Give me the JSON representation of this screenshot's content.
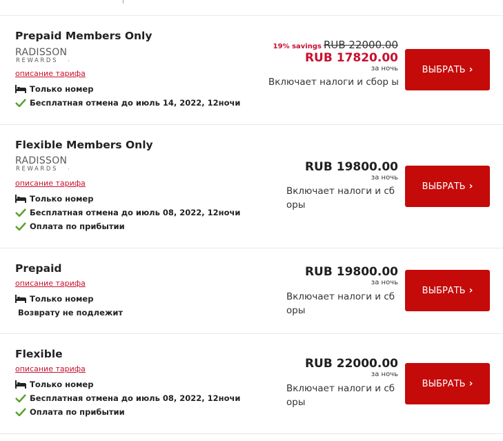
{
  "rates": [
    {
      "title": "Prepaid Members Only",
      "logo_top": "RADISSON",
      "logo_bottom": "REWARDS",
      "description_link": "описание тарифа",
      "features": [
        {
          "icon": "bed-icon",
          "text": "Только номер"
        },
        {
          "icon": "check-icon",
          "text": "Бесплатная отмена до июль 14, 2022, 12ночи"
        }
      ],
      "savings": "19% savings",
      "original_price": "RUB 22000.00",
      "price": "RUB 17820.00",
      "per_night": "за ночь",
      "taxes": "Включает налоги и сбор ы",
      "button_label": "ВЫБРАТЬ",
      "button_arrow": "›"
    },
    {
      "title": "Flexible Members Only",
      "logo_top": "RADISSON",
      "logo_bottom": "REWARDS",
      "description_link": "описание тарифа",
      "features": [
        {
          "icon": "bed-icon",
          "text": "Только номер"
        },
        {
          "icon": "check-icon",
          "text": "Бесплатная отмена до июль 08, 2022, 12ночи"
        },
        {
          "icon": "check-icon",
          "text": "Оплата по прибытии"
        }
      ],
      "price": "RUB 19800.00",
      "per_night": "за ночь",
      "taxes": "Включает налоги и сб оры",
      "button_label": "ВЫБРАТЬ",
      "button_arrow": "›"
    },
    {
      "title": "Prepaid",
      "description_link": "описание тарифа",
      "features": [
        {
          "icon": "bed-icon",
          "text": "Только номер"
        },
        {
          "icon": "",
          "text": "Возврату не подлежит"
        }
      ],
      "price": "RUB 19800.00",
      "per_night": "за ночь",
      "taxes": "Включает налоги и сб оры",
      "button_label": "ВЫБРАТЬ",
      "button_arrow": "›"
    },
    {
      "title": "Flexible",
      "description_link": "описание тарифа",
      "features": [
        {
          "icon": "bed-icon",
          "text": "Только номер"
        },
        {
          "icon": "check-icon",
          "text": "Бесплатная отмена до июль 08, 2022, 12ночи"
        },
        {
          "icon": "check-icon",
          "text": "Оплата по прибытии"
        }
      ],
      "price": "RUB 22000.00",
      "per_night": "за ночь",
      "taxes": "Включает налоги и сб оры",
      "button_label": "ВЫБРАТЬ",
      "button_arrow": "›"
    }
  ],
  "colors": {
    "accent": "#c8102e",
    "button": "#c50a0a",
    "check": "#5aa02c"
  }
}
